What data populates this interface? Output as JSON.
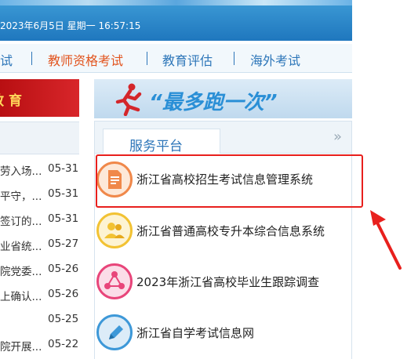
{
  "header": {
    "datetime": "2023年6月5日 星期一 16:57:15"
  },
  "nav": {
    "items": [
      "试",
      "教师资格考试",
      "教育评估",
      "海外考试"
    ],
    "active_index": 1,
    "accent": "#e2541e",
    "color": "#2d76b9"
  },
  "left": {
    "banner_text": "教育",
    "news": [
      {
        "title": "劳入场...",
        "date": "05-31"
      },
      {
        "title": "平守，...",
        "date": "05-31"
      },
      {
        "title": "签订的...",
        "date": "05-31"
      },
      {
        "title": "业省统...",
        "date": "05-27"
      },
      {
        "title": "院党委...",
        "date": "05-26"
      },
      {
        "title": "上确认...",
        "date": "05-26"
      },
      {
        "title": "",
        "date": "05-25"
      },
      {
        "title": "院开展...",
        "date": "05-22"
      }
    ]
  },
  "slogan": {
    "text": "“最多跑一次”",
    "icon": "runner-icon"
  },
  "services": {
    "tab_label": "服务平台",
    "more_icon": "double-chevron-right-icon",
    "items": [
      {
        "label": "浙江省高校招生考试信息管理系统",
        "icon": "document-icon",
        "color": "#f0884a"
      },
      {
        "label": "浙江省普通高校专升本综合信息系统",
        "icon": "users-icon",
        "color": "#f2c233"
      },
      {
        "label": "2023年浙江省高校毕业生跟踪调查",
        "icon": "network-icon",
        "color": "#e8457a"
      },
      {
        "label": "浙江省自学考试信息网",
        "icon": "pencil-icon",
        "color": "#3d98d8"
      }
    ]
  },
  "annotation": {
    "highlight_color": "#e8201d"
  }
}
